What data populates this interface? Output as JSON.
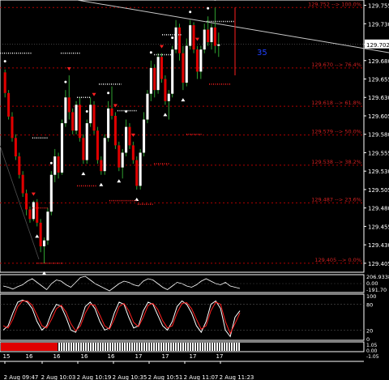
{
  "chart_data": {
    "type": "candlestick",
    "symbol_marker": "35",
    "price_axis": {
      "ylim": [
        129.395,
        129.76
      ],
      "ticks": [
        "129.755",
        "129.730",
        "129.702",
        "129.680",
        "129.655",
        "129.630",
        "129.605",
        "129.580",
        "129.555",
        "129.530",
        "129.505",
        "129.480",
        "129.455",
        "129.430",
        "129.405"
      ],
      "tick_values": [
        129.755,
        129.73,
        129.702,
        129.68,
        129.655,
        129.63,
        129.605,
        129.58,
        129.555,
        129.53,
        129.505,
        129.48,
        129.455,
        129.43,
        129.405
      ],
      "current_price": "129.702",
      "current_value": 129.702
    },
    "fib_levels": [
      {
        "label": "129.752 --> 100.0%",
        "value": 129.752
      },
      {
        "label": "129.670 --> 76.4%",
        "value": 129.67
      },
      {
        "label": "129.618 --> 61.8%",
        "value": 129.618
      },
      {
        "label": "129.579 --> 50.0%",
        "value": 129.579
      },
      {
        "label": "129.538 --> 38.2%",
        "value": 129.538
      },
      {
        "label": "129.487 --> 23.6%",
        "value": 129.487
      },
      {
        "label": "129.405 --> 0.0%",
        "value": 129.405
      }
    ],
    "time_axis": {
      "labels": [
        "2 Aug 09:47",
        "2 Aug 10:03",
        "2 Aug 10:19",
        "2 Aug 10:35",
        "2 Aug 10:51",
        "2 Aug 11:07",
        "2 Aug 11:23"
      ]
    },
    "indicator1": {
      "labels": [
        "206.9338",
        "0.00",
        "-191.70"
      ],
      "values": [
        20,
        10,
        -5,
        15,
        30,
        60,
        80,
        50,
        20,
        -10,
        40,
        70,
        60,
        30,
        10,
        50,
        90,
        100,
        70,
        40,
        20,
        0,
        -20,
        10,
        40,
        60,
        50,
        30,
        20,
        60,
        80,
        70,
        40,
        10,
        -10,
        20,
        50,
        40,
        20,
        10,
        30,
        60,
        80,
        60,
        40,
        30,
        50,
        20,
        10,
        0
      ]
    },
    "indicator2": {
      "labels": [
        "100",
        "80",
        "20",
        "0"
      ],
      "series": [
        {
          "color": "#ffffff",
          "values": [
            20,
            30,
            60,
            85,
            90,
            85,
            70,
            40,
            20,
            30,
            60,
            80,
            75,
            50,
            20,
            15,
            40,
            75,
            85,
            70,
            40,
            20,
            25,
            60,
            85,
            80,
            50,
            25,
            30,
            65,
            85,
            80,
            55,
            30,
            20,
            40,
            75,
            88,
            80,
            60,
            30,
            15,
            40,
            80,
            88,
            70,
            20,
            5,
            50,
            65
          ]
        },
        {
          "color": "#ff2020",
          "values": [
            30,
            25,
            45,
            75,
            88,
            88,
            78,
            55,
            30,
            25,
            45,
            70,
            78,
            62,
            35,
            18,
            30,
            60,
            80,
            78,
            55,
            30,
            22,
            45,
            75,
            82,
            65,
            38,
            28,
            50,
            78,
            82,
            68,
            42,
            25,
            30,
            60,
            82,
            84,
            70,
            45,
            22,
            30,
            65,
            85,
            80,
            40,
            12,
            35,
            60
          ]
        }
      ]
    },
    "bottom_strip": {
      "labels": [
        "15",
        "16",
        "16",
        "16",
        "16",
        "17",
        "17",
        "17",
        "17"
      ],
      "right_labels": [
        "1.05",
        "0.00",
        "-1.05"
      ]
    },
    "candles": [
      [
        129.664,
        129.668,
        129.63,
        129.636
      ],
      [
        129.636,
        129.64,
        129.6,
        129.604
      ],
      [
        129.604,
        129.61,
        129.57,
        129.575
      ],
      [
        129.575,
        129.58,
        129.545,
        129.55
      ],
      [
        129.55,
        129.555,
        129.52,
        129.525
      ],
      [
        129.525,
        129.53,
        129.495,
        129.5
      ],
      [
        129.5,
        129.505,
        129.47,
        129.478
      ],
      [
        129.478,
        129.482,
        129.46,
        129.465
      ],
      [
        129.465,
        129.49,
        129.462,
        129.488
      ],
      [
        129.488,
        129.492,
        129.455,
        129.46
      ],
      [
        129.46,
        129.465,
        129.42,
        129.428
      ],
      [
        129.428,
        129.44,
        129.405,
        129.436
      ],
      [
        129.436,
        129.48,
        129.43,
        129.475
      ],
      [
        129.475,
        129.53,
        129.47,
        129.525
      ],
      [
        129.525,
        129.56,
        129.515,
        129.55
      ],
      [
        129.55,
        129.555,
        129.52,
        129.528
      ],
      [
        129.528,
        129.6,
        129.525,
        129.595
      ],
      [
        129.595,
        129.64,
        129.59,
        129.63
      ],
      [
        129.63,
        129.66,
        129.6,
        129.61
      ],
      [
        129.61,
        129.615,
        129.58,
        129.585
      ],
      [
        129.585,
        129.625,
        129.58,
        129.62
      ],
      [
        129.62,
        129.63,
        129.57,
        129.575
      ],
      [
        129.575,
        129.58,
        129.54,
        129.545
      ],
      [
        129.545,
        129.6,
        129.54,
        129.595
      ],
      [
        129.595,
        129.63,
        129.59,
        129.62
      ],
      [
        129.62,
        129.625,
        129.58,
        129.585
      ],
      [
        129.585,
        129.59,
        129.54,
        129.545
      ],
      [
        129.545,
        129.55,
        129.525,
        129.53
      ],
      [
        129.53,
        129.58,
        129.525,
        129.575
      ],
      [
        129.575,
        129.625,
        129.57,
        129.615
      ],
      [
        129.615,
        129.645,
        129.6,
        129.605
      ],
      [
        129.605,
        129.61,
        129.56,
        129.565
      ],
      [
        129.565,
        129.57,
        129.53,
        129.535
      ],
      [
        129.535,
        129.56,
        129.52,
        129.555
      ],
      [
        129.555,
        129.6,
        129.55,
        129.59
      ],
      [
        129.59,
        129.595,
        129.56,
        129.565
      ],
      [
        129.565,
        129.57,
        129.54,
        129.545
      ],
      [
        129.545,
        129.55,
        129.505,
        129.51
      ],
      [
        129.51,
        129.56,
        129.505,
        129.555
      ],
      [
        129.555,
        129.61,
        129.55,
        129.6
      ],
      [
        129.6,
        129.64,
        129.595,
        129.635
      ],
      [
        129.635,
        129.68,
        129.625,
        129.67
      ],
      [
        129.67,
        129.675,
        129.63,
        129.64
      ],
      [
        129.64,
        129.69,
        129.635,
        129.685
      ],
      [
        129.685,
        129.69,
        129.65,
        129.655
      ],
      [
        129.655,
        129.66,
        129.62,
        129.625
      ],
      [
        129.625,
        129.64,
        129.6,
        129.635
      ],
      [
        129.635,
        129.7,
        129.63,
        129.695
      ],
      [
        129.695,
        129.735,
        129.69,
        129.725
      ],
      [
        129.725,
        129.73,
        129.68,
        129.69
      ],
      [
        129.69,
        129.7,
        129.64,
        129.65
      ],
      [
        129.65,
        129.71,
        129.645,
        129.7
      ],
      [
        129.7,
        129.735,
        129.695,
        129.728
      ],
      [
        129.728,
        129.732,
        129.69,
        129.695
      ],
      [
        129.695,
        129.7,
        129.655,
        129.665
      ],
      [
        129.665,
        129.7,
        129.655,
        129.695
      ],
      [
        129.695,
        129.73,
        129.69,
        129.722
      ],
      [
        129.722,
        129.74,
        129.7,
        129.705
      ],
      [
        129.705,
        129.73,
        129.695,
        129.725
      ],
      [
        129.725,
        129.752,
        129.69,
        129.7
      ],
      [
        129.7,
        129.718,
        129.685,
        129.702
      ]
    ]
  }
}
